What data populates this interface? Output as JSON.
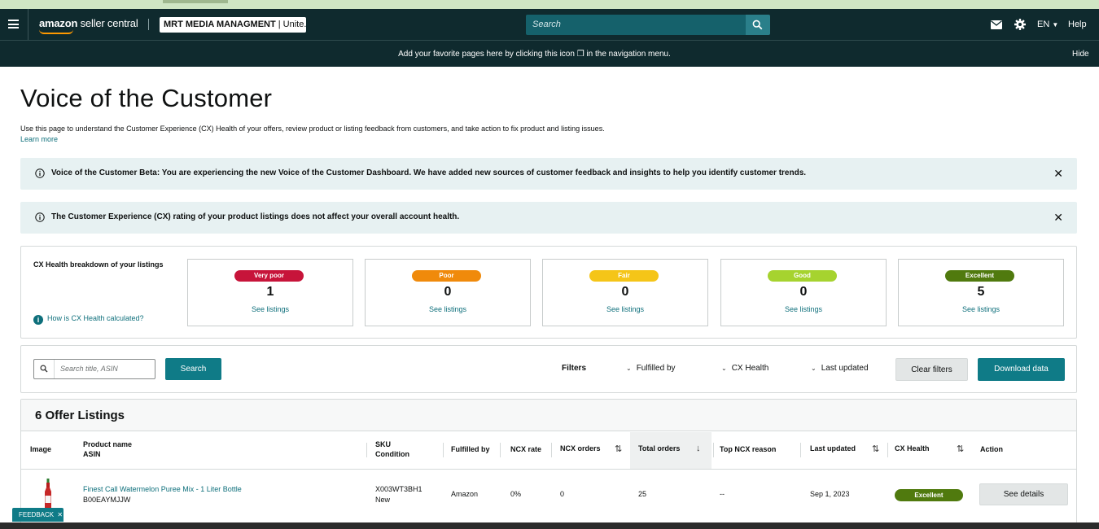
{
  "colors": {
    "topbar": "#0f2a2e",
    "accent": "#0f7b87",
    "link": "#0e6f7b",
    "very_poor": "#c7143a",
    "poor": "#f08a0b",
    "fair": "#f5c518",
    "good": "#a6d32f",
    "excellent": "#507a0e"
  },
  "topbar": {
    "logo_brand": "amazon",
    "logo_suffix": "seller central",
    "account_name": "MRT MEDIA MANAGMENT",
    "account_market": "| Unite...",
    "search_placeholder": "Search",
    "language": "EN",
    "help": "Help",
    "icons": [
      "menu-icon",
      "search-icon",
      "mail-icon",
      "gear-icon",
      "chevron-down-icon"
    ]
  },
  "favorites_bar": {
    "message": "Add your favorite pages here by clicking this icon ❒ in the navigation menu.",
    "hide": "Hide"
  },
  "page": {
    "title": "Voice of the Customer",
    "description": "Use this page to understand the Customer Experience (CX) Health of your offers, review product or listing feedback from customers, and take action to fix product and listing issues.",
    "learn_more": "Learn more"
  },
  "alerts": [
    {
      "text": "Voice of the Customer Beta: You are experiencing the new Voice of the Customer Dashboard. We have added new sources of customer feedback and insights to help you identify customer trends.",
      "close": "✕"
    },
    {
      "text": "The Customer Experience (CX) rating of your product listings does not affect your overall account health.",
      "close": "✕"
    }
  ],
  "cx_health": {
    "label": "CX Health breakdown of your listings",
    "how_link": "How is CX Health calculated?",
    "cards": [
      {
        "rating": "Very poor",
        "count": "1",
        "link": "See listings",
        "color": "#c7143a"
      },
      {
        "rating": "Poor",
        "count": "0",
        "link": "See listings",
        "color": "#f08a0b"
      },
      {
        "rating": "Fair",
        "count": "0",
        "link": "See listings",
        "color": "#f5c518"
      },
      {
        "rating": "Good",
        "count": "0",
        "link": "See listings",
        "color": "#a6d32f"
      },
      {
        "rating": "Excellent",
        "count": "5",
        "link": "See listings",
        "color": "#507a0e"
      }
    ]
  },
  "filters": {
    "search_placeholder": "Search title, ASIN",
    "search_button": "Search",
    "label": "Filters",
    "dropdowns": [
      "Fulfilled by",
      "CX Health",
      "Last updated"
    ],
    "clear_button": "Clear filters",
    "download_button": "Download data"
  },
  "table": {
    "title": "6 Offer Listings",
    "columns": {
      "image": "Image",
      "product_name": "Product name",
      "asin": "ASIN",
      "sku": "SKU",
      "condition": "Condition",
      "fulfilled_by": "Fulfilled by",
      "ncx_rate": "NCX rate",
      "ncx_orders": "NCX orders",
      "total_orders": "Total orders",
      "top_ncx_reason": "Top NCX reason",
      "last_updated": "Last updated",
      "cx_health": "CX Health",
      "action": "Action"
    },
    "rows": [
      {
        "product_name": "Finest Call Watermelon Puree Mix - 1 Liter Bottle",
        "asin": "B00EAYMJJW",
        "sku": "X003WT3BH1",
        "condition": "New",
        "fulfilled_by": "Amazon",
        "ncx_rate": "0%",
        "ncx_orders": "0",
        "total_orders": "25",
        "top_ncx_reason": "--",
        "last_updated": "Sep 1, 2023",
        "cx_health": "Excellent",
        "action": "See details"
      }
    ]
  },
  "feedback": {
    "label": "FEEDBACK",
    "close": "✕"
  }
}
